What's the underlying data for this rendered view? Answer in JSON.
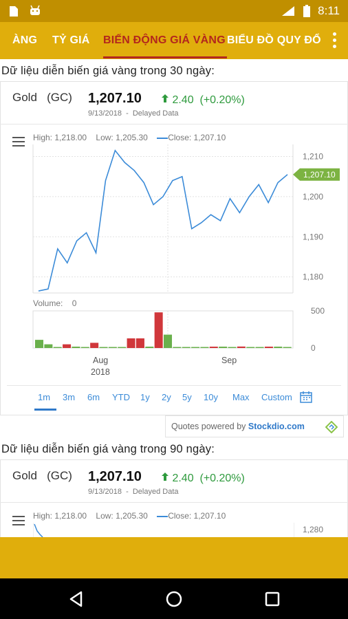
{
  "status_bar": {
    "time": "8:11",
    "battery_level": "8"
  },
  "tabs": {
    "items": [
      {
        "label": "ÀNG"
      },
      {
        "label": "TỶ GIÁ"
      },
      {
        "label": "BIẾN ĐỘNG GIÁ VÀNG"
      },
      {
        "label": "BIỂU ĐỒ QUY ĐỔ"
      }
    ],
    "active_index": 2
  },
  "section1": {
    "title": "Dữ liệu diễn biến giá vàng trong 30 ngày:"
  },
  "section2": {
    "title": "Dữ liệu diễn biến giá vàng trong 90 ngày:"
  },
  "quote": {
    "name": "Gold",
    "symbol": "(GC)",
    "price": "1,207.10",
    "change": "2.40",
    "change_pct": "(+0.20%)",
    "date": "9/13/2018",
    "sep": "-",
    "delayed": "Delayed Data"
  },
  "legend": {
    "high_label": "High:",
    "high": "1,218.00",
    "low_label": "Low:",
    "low": "1,205.30",
    "close_label": "Close:",
    "close": "1,207.10"
  },
  "volume": {
    "label": "Volume:",
    "value": "0"
  },
  "ranges": {
    "items": [
      "1m",
      "3m",
      "6m",
      "YTD",
      "1y",
      "2y",
      "5y",
      "10y",
      "Max",
      "Custom"
    ],
    "selected": "1m"
  },
  "powered": {
    "prefix": "Quotes powered by",
    "brand": "Stockdio.com"
  },
  "chart_data": [
    {
      "type": "line",
      "title": "",
      "x_ticks": [
        "Aug 2018",
        "Sep"
      ],
      "y_ticks": [
        1180,
        1190,
        1200,
        1210
      ],
      "ylim": [
        1176,
        1213
      ],
      "current_label": "1,207.10",
      "series": [
        {
          "name": "Close",
          "values": [
            1176.5,
            1177,
            1187,
            1183.5,
            1189,
            1191,
            1186,
            1204,
            1211.5,
            1208.5,
            1206.5,
            1203.5,
            1198,
            1200,
            1204,
            1205,
            1192,
            1193.5,
            1195.5,
            1194,
            1199.5,
            1196,
            1200,
            1203,
            1198.5,
            1203.5,
            1205.5
          ]
        }
      ],
      "color": "#3b8bd8"
    },
    {
      "type": "bar",
      "title": "",
      "ylabel": "Volume",
      "y_ticks": [
        0,
        500
      ],
      "ylim": [
        0,
        500
      ],
      "values": [
        110,
        50,
        0,
        50,
        10,
        0,
        70,
        0,
        0,
        0,
        130,
        130,
        10,
        480,
        180,
        0,
        0,
        0,
        0,
        15,
        15,
        0,
        20,
        0,
        0,
        15,
        15,
        0
      ],
      "colors": [
        "up",
        "up",
        "up",
        "down",
        "up",
        "up",
        "down",
        "up",
        "up",
        "up",
        "down",
        "down",
        "up",
        "down",
        "up",
        "up",
        "up",
        "up",
        "up",
        "down",
        "up",
        "up",
        "down",
        "up",
        "up",
        "down",
        "up",
        "up"
      ]
    }
  ],
  "chart2_preview": {
    "y_tick": "1,280"
  }
}
